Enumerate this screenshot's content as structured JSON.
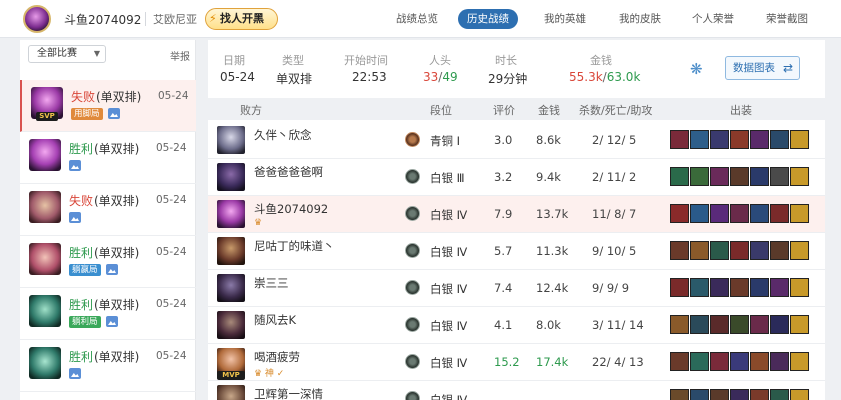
{
  "topbar": {
    "player_name": "斗鱼2074092",
    "server": "艾欧尼亚",
    "find_button": "找人开黑",
    "nav": [
      {
        "label": "战绩总览",
        "active": false
      },
      {
        "label": "历史战绩",
        "active": true
      },
      {
        "label": "我的英雄",
        "active": false
      },
      {
        "label": "我的皮肤",
        "active": false
      },
      {
        "label": "个人荣誉",
        "active": false
      },
      {
        "label": "荣誉截图",
        "active": false
      }
    ]
  },
  "left": {
    "filter": "全部比赛",
    "report": "举报",
    "matches": [
      {
        "result": "失败",
        "result_type": "lose",
        "mode": "(单双排)",
        "date": "05-24",
        "tag": "用脚局",
        "tag_color": "orange",
        "svp": "SVP",
        "active": true
      },
      {
        "result": "胜利",
        "result_type": "win",
        "mode": "(单双排)",
        "date": "05-24",
        "tag": "",
        "tag_color": "",
        "svp": "",
        "active": false
      },
      {
        "result": "失败",
        "result_type": "lose",
        "mode": "(单双排)",
        "date": "05-24",
        "tag": "",
        "tag_color": "",
        "svp": "",
        "active": false
      },
      {
        "result": "胜利",
        "result_type": "win",
        "mode": "(单双排)",
        "date": "05-24",
        "tag": "躺赢局",
        "tag_color": "blue",
        "svp": "",
        "active": false
      },
      {
        "result": "胜利",
        "result_type": "win",
        "mode": "(单双排)",
        "date": "05-24",
        "tag": "躺利局",
        "tag_color": "green",
        "svp": "",
        "active": false
      },
      {
        "result": "胜利",
        "result_type": "win",
        "mode": "(单双排)",
        "date": "05-24",
        "tag": "",
        "tag_color": "",
        "svp": "",
        "active": false
      }
    ]
  },
  "summary": {
    "date_label": "日期",
    "date": "05-24",
    "type_label": "类型",
    "type": "单双排",
    "start_label": "开始时间",
    "start": "22:53",
    "kills_label": "人头",
    "kills_team": "33",
    "kills_sep": "/",
    "kills_enemy": "49",
    "duration_label": "时长",
    "duration": "29分钟",
    "money_label": "金钱",
    "money_team": "55.3k",
    "money_sep": "/",
    "money_enemy": "63.0k",
    "chart_button": "数据图表"
  },
  "table": {
    "headers": {
      "side": "败方",
      "rank": "段位",
      "score": "评价",
      "gold": "金钱",
      "kda": "杀数/死亡/助攻",
      "items": "出装"
    },
    "rows": [
      {
        "name": "久伴丶欣念",
        "sub": "",
        "rank": "青铜 Ⅰ",
        "rank_tier": "bronze",
        "score": "3.0",
        "gold": "8.6k",
        "kda": "2/ 12/ 5",
        "me": false,
        "highlight": false
      },
      {
        "name": "爸爸爸爸爸啊",
        "sub": "",
        "rank": "白银 Ⅲ",
        "rank_tier": "silver",
        "score": "3.2",
        "gold": "9.4k",
        "kda": "2/ 11/ 2",
        "me": false,
        "highlight": false
      },
      {
        "name": "斗鱼2074092",
        "sub": "♛",
        "rank": "白银 Ⅳ",
        "rank_tier": "silver",
        "score": "7.9",
        "gold": "13.7k",
        "kda": "11/ 8/ 7",
        "me": true,
        "highlight": false
      },
      {
        "name": "尼咕丁的味道丶",
        "sub": "",
        "rank": "白银 Ⅳ",
        "rank_tier": "silver",
        "score": "5.7",
        "gold": "11.3k",
        "kda": "9/ 10/ 5",
        "me": false,
        "highlight": false
      },
      {
        "name": "崇三三",
        "sub": "",
        "rank": "白银 Ⅳ",
        "rank_tier": "silver",
        "score": "7.4",
        "gold": "12.4k",
        "kda": "9/ 9/ 9",
        "me": false,
        "highlight": false
      },
      {
        "name": "随风去K",
        "sub": "",
        "rank": "白银 Ⅳ",
        "rank_tier": "silver",
        "score": "4.1",
        "gold": "8.0k",
        "kda": "3/ 11/ 14",
        "me": false,
        "highlight": false
      },
      {
        "name": "喝酒疲劳",
        "sub": "♛ 神 ✓",
        "rank": "白银 Ⅳ",
        "rank_tier": "silver",
        "score": "15.2",
        "gold": "17.4k",
        "kda": "22/ 4/ 13",
        "me": false,
        "highlight": true
      },
      {
        "name": "卫辉第一深情",
        "sub": "",
        "rank": "白银 Ⅳ",
        "rank_tier": "silver",
        "score": "",
        "gold": "",
        "kda": "",
        "me": false,
        "highlight": false
      }
    ]
  },
  "colors": {
    "lose": "#d9473a",
    "win": "#2e9a4e",
    "accent": "#2d6fb1"
  }
}
